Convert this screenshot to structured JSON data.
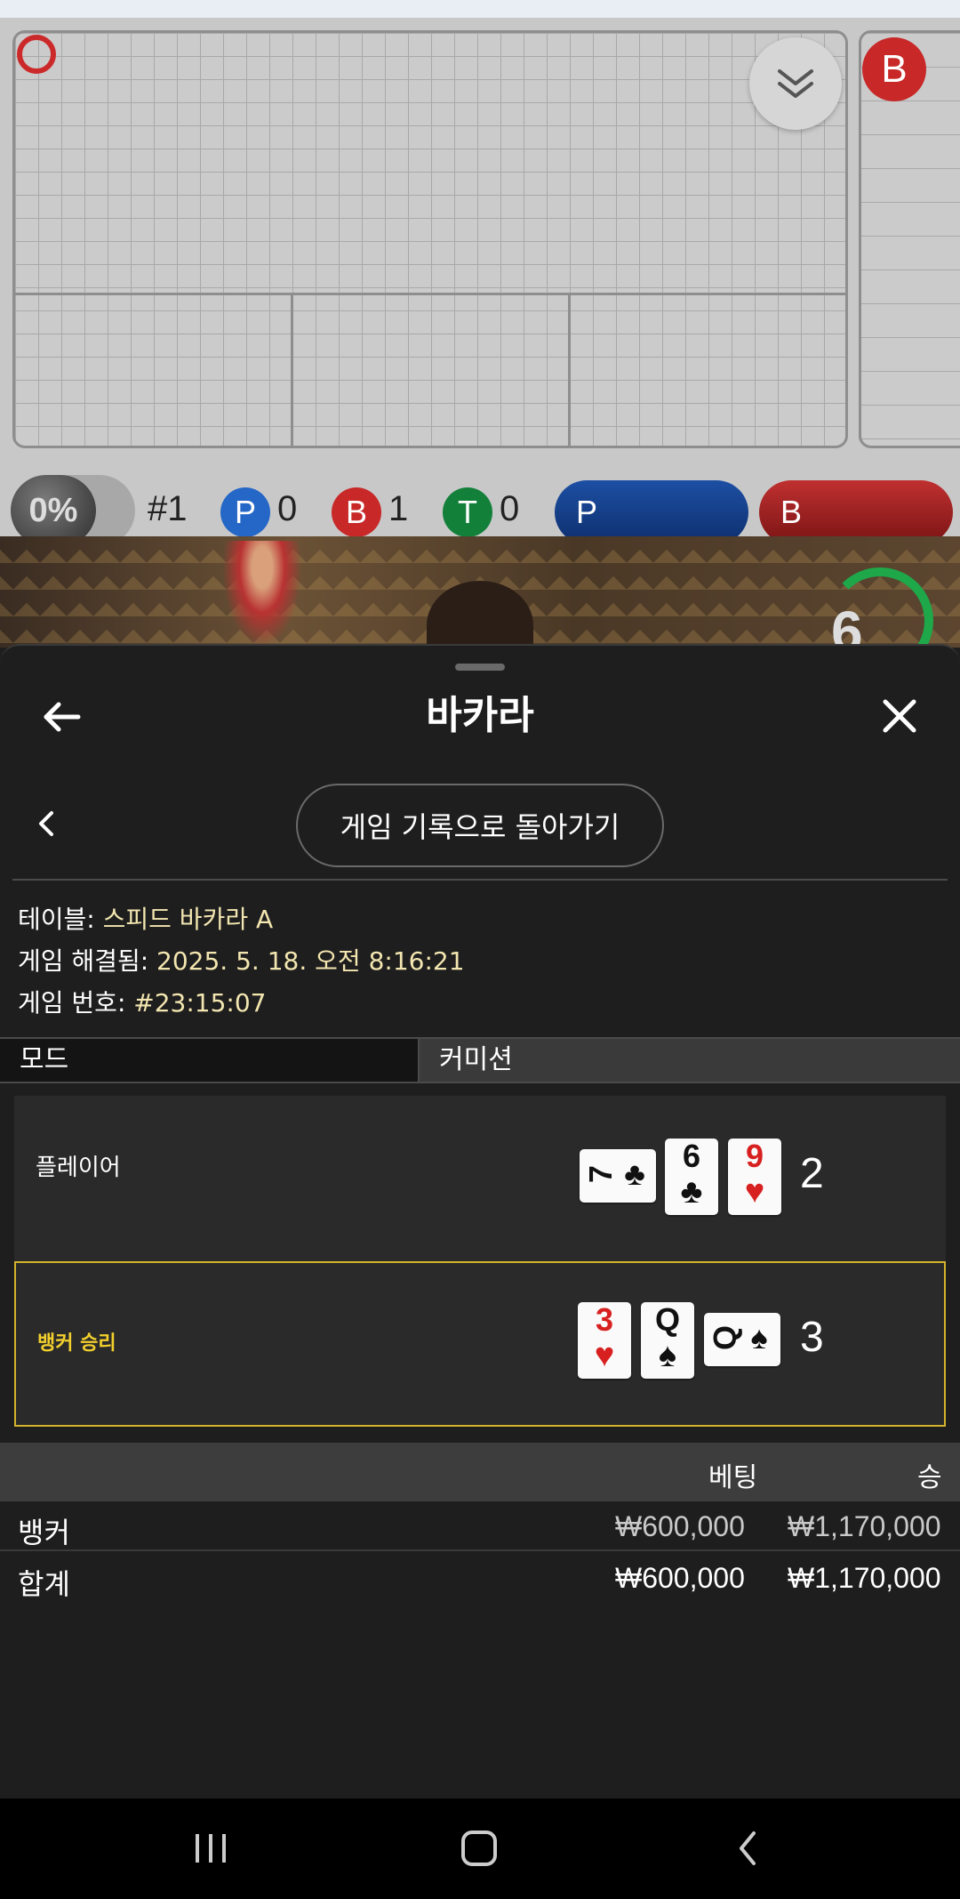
{
  "roadmap": {
    "pct_label": "0%",
    "round_label": "#1",
    "badges": [
      {
        "letter": "P",
        "count": "0",
        "color": "#2467c7"
      },
      {
        "letter": "B",
        "count": "1",
        "color": "#c82828"
      },
      {
        "letter": "T",
        "count": "0",
        "color": "#13803a"
      }
    ],
    "pill_player": "P",
    "pill_banker": "B",
    "side_badge": "B"
  },
  "video": {
    "timer": "6"
  },
  "sheet": {
    "title": "바카라",
    "return_label": "게임 기록으로 돌아가기",
    "info": {
      "table_label": "테이블:",
      "table_value": "스피드 바카라 A",
      "resolved_label": "게임 해결됨:",
      "resolved_value": "2025. 5. 18. 오전 8:16:21",
      "number_label": "게임 번호:",
      "number_value": "#23:15:07"
    },
    "tabs": {
      "mode": "모드",
      "commission": "커미션"
    },
    "player": {
      "label": "플레이어",
      "score": "2",
      "cards": [
        {
          "rank": "7",
          "suit": "♣",
          "color": "black",
          "sideways": true
        },
        {
          "rank": "6",
          "suit": "♣",
          "color": "black",
          "sideways": false
        },
        {
          "rank": "9",
          "suit": "♥",
          "color": "red",
          "sideways": false
        }
      ]
    },
    "banker": {
      "label": "뱅커 승리",
      "score": "3",
      "cards": [
        {
          "rank": "3",
          "suit": "♥",
          "color": "red",
          "sideways": false
        },
        {
          "rank": "Q",
          "suit": "♠",
          "color": "black",
          "sideways": false
        },
        {
          "rank": "Q",
          "suit": "♠",
          "color": "black",
          "sideways": true
        }
      ]
    },
    "bets": {
      "header_bet": "베팅",
      "header_win": "승",
      "rows": [
        {
          "name": "뱅커",
          "bet": "₩600,000",
          "win": "₩1,170,000"
        }
      ],
      "total": {
        "name": "합계",
        "bet": "₩600,000",
        "win": "₩1,170,000"
      }
    }
  }
}
